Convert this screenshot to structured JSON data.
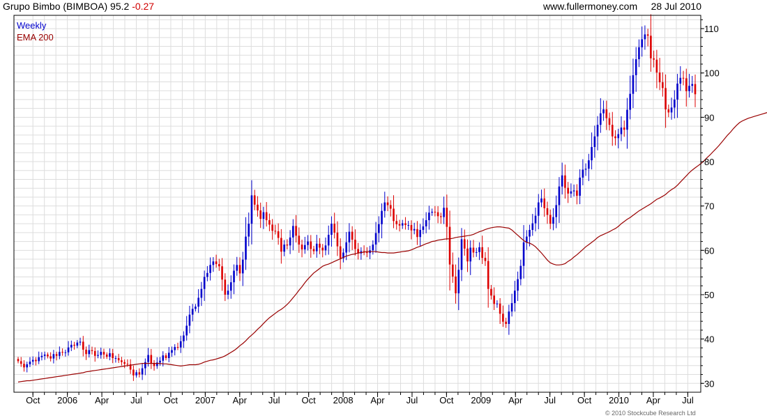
{
  "header": {
    "symbol": "Grupo Bimbo (BIMBOA)",
    "price": "95.2",
    "change": "-0.27",
    "site": "www.fullermoney.com",
    "date": "28 Jul 2010"
  },
  "copyright": "© 2010 Stockcube Research Ltd",
  "colors": {
    "up": "#0000cc",
    "down": "#dd0000",
    "ema": "#990000",
    "grid": "#dddddd"
  },
  "chart_data": {
    "type": "candlestick",
    "ylim": [
      28,
      113
    ],
    "yticks": [
      30,
      40,
      50,
      60,
      70,
      80,
      90,
      100,
      110
    ],
    "xticks": [
      "Oct",
      "2006",
      "Apr",
      "Jul",
      "Oct",
      "2007",
      "Apr",
      "Jul",
      "Oct",
      "2008",
      "Apr",
      "Jul",
      "Oct",
      "2009",
      "Apr",
      "Jul",
      "Oct",
      "2010",
      "Apr",
      "Jul"
    ],
    "grid": true,
    "y_axis_side": "right",
    "legend_position": "top-left",
    "series": [
      {
        "name": "Weekly",
        "kind": "weekly candles, approximate closes",
        "values": [
          35.0,
          34.4,
          33.6,
          34.3,
          34.9,
          35.3,
          35.0,
          35.9,
          36.2,
          36.5,
          36.1,
          35.6,
          36.6,
          36.2,
          37.1,
          37.0,
          37.0,
          38.1,
          38.7,
          38.5,
          39.2,
          39.4,
          37.6,
          36.6,
          37.5,
          37.3,
          36.2,
          36.4,
          37.1,
          36.5,
          36.0,
          36.8,
          35.7,
          35.7,
          35.2,
          34.8,
          34.4,
          34.3,
          33.1,
          31.8,
          32.5,
          32.0,
          33.4,
          34.8,
          36.4,
          34.6,
          33.9,
          34.7,
          35.1,
          36.3,
          35.7,
          36.9,
          37.5,
          38.2,
          38.1,
          39.5,
          40.8,
          43.0,
          45.5,
          46.8,
          47.3,
          49.3,
          51.3,
          54.0,
          54.9,
          56.7,
          57.5,
          56.9,
          56.4,
          53.4,
          50.0,
          50.9,
          52.8,
          55.4,
          56.7,
          54.8,
          57.9,
          63.1,
          66.0,
          72.4,
          70.3,
          69.0,
          67.1,
          68.6,
          66.8,
          65.8,
          64.4,
          64.3,
          62.8,
          59.7,
          61.3,
          61.1,
          62.9,
          65.5,
          63.3,
          61.3,
          60.2,
          61.2,
          62.0,
          60.3,
          59.8,
          61.5,
          60.6,
          60.0,
          61.1,
          63.5,
          66.0,
          64.0,
          60.9,
          58.2,
          59.5,
          61.8,
          64.2,
          62.4,
          60.3,
          59.3,
          59.8,
          59.6,
          59.4,
          60.0,
          61.3,
          63.9,
          65.9,
          68.9,
          70.8,
          70.2,
          69.4,
          66.6,
          65.9,
          65.6,
          66.1,
          65.7,
          65.7,
          64.5,
          64.8,
          63.0,
          64.6,
          65.4,
          66.8,
          68.5,
          68.7,
          68.6,
          67.7,
          67.5,
          69.6,
          65.3,
          56.8,
          54.1,
          50.3,
          55.6,
          62.5,
          60.4,
          57.5,
          60.6,
          59.5,
          59.6,
          60.7,
          58.3,
          57.6,
          51.3,
          49.8,
          47.9,
          48.0,
          45.7,
          43.9,
          43.4,
          46.2,
          48.1,
          50.9,
          53.5,
          56.5,
          61.8,
          63.1,
          64.6,
          66.1,
          67.8,
          70.8,
          71.7,
          69.5,
          68.0,
          66.0,
          67.5,
          70.2,
          74.4,
          76.9,
          74.1,
          72.8,
          73.3,
          73.5,
          72.3,
          76.4,
          78.2,
          78.4,
          80.3,
          83.3,
          85.7,
          88.3,
          90.9,
          91.8,
          89.8,
          88.3,
          85.7,
          85.3,
          86.2,
          87.7,
          87.2,
          91.7,
          95.3,
          99.5,
          103.1,
          105.8,
          107.6,
          108.7,
          108.4,
          103.3,
          103.0,
          100.1,
          97.9,
          96.6,
          91.8,
          91.1,
          92.2,
          94.0,
          97.6,
          98.9,
          98.8,
          95.9,
          97.1,
          97.5,
          95.2
        ]
      },
      {
        "name": "EMA 200",
        "kind": "exponential moving average",
        "values": [
          30.3,
          30.4,
          30.5,
          30.6,
          30.6,
          30.7,
          30.8,
          30.9,
          31.0,
          31.1,
          31.2,
          31.3,
          31.4,
          31.5,
          31.6,
          31.7,
          31.8,
          31.9,
          32.0,
          32.1,
          32.2,
          32.3,
          32.4,
          32.6,
          32.7,
          32.8,
          32.9,
          33.0,
          33.1,
          33.2,
          33.3,
          33.4,
          33.5,
          33.6,
          33.7,
          33.8,
          33.9,
          34.0,
          34.1,
          34.2,
          34.3,
          34.4,
          34.5,
          34.5,
          34.5,
          34.5,
          34.5,
          34.5,
          34.5,
          34.4,
          34.4,
          34.3,
          34.2,
          34.1,
          34.0,
          33.9,
          34.0,
          34.1,
          34.2,
          34.2,
          34.2,
          34.3,
          34.5,
          34.8,
          35.0,
          35.2,
          35.3,
          35.5,
          35.7,
          35.9,
          36.2,
          36.6,
          37.0,
          37.4,
          37.9,
          38.5,
          39.0,
          39.6,
          40.3,
          40.9,
          41.5,
          42.2,
          42.8,
          43.5,
          44.2,
          44.8,
          45.3,
          45.8,
          46.3,
          46.7,
          47.2,
          47.8,
          48.5,
          49.3,
          50.1,
          51.0,
          51.8,
          52.7,
          53.5,
          54.2,
          54.9,
          55.4,
          55.9,
          56.4,
          56.7,
          56.9,
          57.2,
          57.5,
          57.8,
          58.1,
          58.4,
          58.7,
          58.9,
          59.1,
          59.2,
          59.4,
          59.5,
          59.6,
          59.7,
          59.7,
          59.7,
          59.7,
          59.6,
          59.5,
          59.5,
          59.4,
          59.4,
          59.4,
          59.5,
          59.6,
          59.7,
          59.8,
          59.9,
          60.1,
          60.4,
          60.7,
          60.9,
          61.2,
          61.5,
          61.7,
          62.0,
          62.1,
          62.3,
          62.4,
          62.5,
          62.6,
          62.6,
          62.7,
          62.9,
          63.0,
          63.1,
          63.2,
          63.3,
          63.4,
          63.6,
          63.9,
          64.2,
          64.4,
          64.7,
          64.9,
          65.1,
          65.2,
          65.3,
          65.3,
          65.2,
          65.1,
          65.0,
          64.6,
          64.0,
          63.4,
          62.8,
          62.2,
          61.8,
          61.6,
          61.3,
          60.8,
          60.1,
          59.4,
          58.6,
          57.8,
          57.2,
          56.9,
          56.7,
          56.7,
          56.8,
          57.0,
          57.5,
          57.9,
          58.5,
          59.0,
          59.6,
          60.2,
          60.8,
          61.3,
          61.8,
          62.3,
          62.9,
          63.3,
          63.6,
          63.9,
          64.2,
          64.6,
          64.9,
          65.4,
          66.0,
          66.5,
          67.0,
          67.4,
          67.9,
          68.4,
          68.9,
          69.3,
          69.7,
          70.1,
          70.5,
          71.0,
          71.5,
          71.8,
          72.2,
          72.6,
          73.2,
          73.7,
          74.1,
          74.7,
          75.4,
          76.1,
          76.8,
          77.5,
          78.1,
          78.6,
          79.1,
          79.6,
          80.2,
          80.9,
          81.5,
          82.2,
          82.9,
          83.6,
          84.4,
          85.2,
          86.0,
          86.7,
          87.5,
          88.2,
          88.8,
          89.2,
          89.5,
          89.8,
          90.0,
          90.2,
          90.4,
          90.6,
          90.8,
          91.0,
          91.2,
          91.4,
          91.6,
          91.9
        ]
      }
    ]
  }
}
